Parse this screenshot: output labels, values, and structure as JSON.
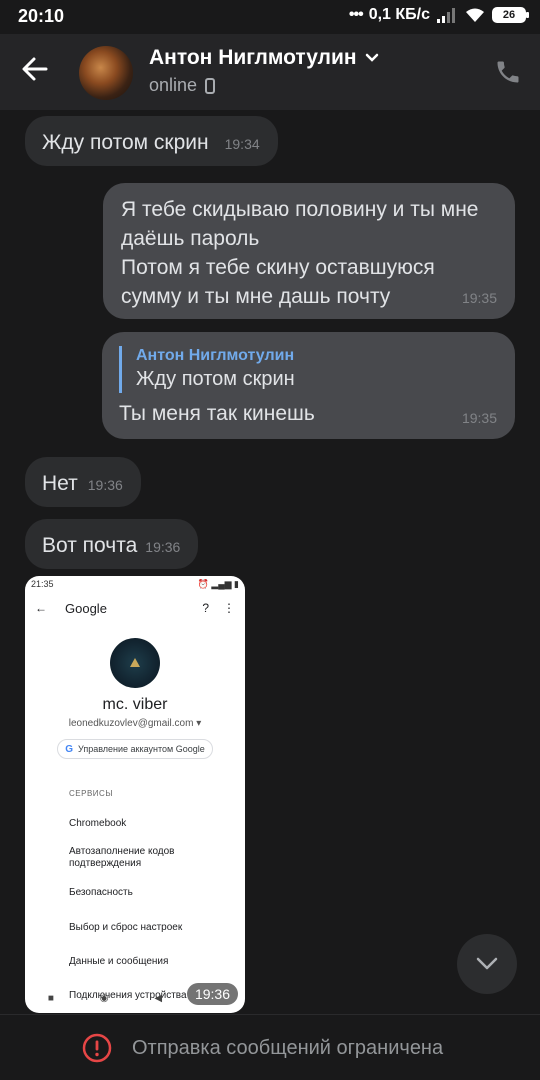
{
  "status_bar": {
    "time": "20:10",
    "network_speed": "0,1 КБ/с",
    "battery": "26"
  },
  "header": {
    "contact_name": "Антон Ниглмотулин",
    "status": "online"
  },
  "messages": [
    {
      "direction": "incoming",
      "text": "Жду потом скрин",
      "time": "19:34"
    },
    {
      "direction": "outgoing",
      "lines": [
        "Я тебе скидываю половину и ты мне",
        "даёшь пароль",
        "Потом я тебе скину оставшуюся",
        "сумму и ты мне дашь почту"
      ],
      "time": "19:35"
    },
    {
      "direction": "outgoing",
      "reply_author": "Антон Ниглмотулин",
      "reply_text": "Жду потом скрин",
      "text": "Ты меня так кинешь",
      "time": "19:35"
    },
    {
      "direction": "incoming",
      "text": "Нет",
      "time": "19:36"
    },
    {
      "direction": "incoming",
      "text": "Вот почта",
      "time": "19:36"
    },
    {
      "direction": "incoming",
      "type": "image",
      "time": "19:36"
    }
  ],
  "screenshot": {
    "status_time": "21:35",
    "app_title": "Google",
    "account_name": "mc. viber",
    "email": "leonedkuzovlev@gmail.com",
    "manage_label": "Управление аккаунтом Google",
    "section": "СЕРВИСЫ",
    "items": [
      "Chromebook",
      "Автозаполнение кодов подтверждения",
      "Безопасность",
      "Выбор и сброс настроек",
      "Данные и сообщения",
      "Подключения устройства"
    ]
  },
  "bottom": {
    "restriction_text": "Отправка сообщений ограничена"
  },
  "colors": {
    "background": "#19191a",
    "header": "#252527",
    "incoming_bubble": "#2c2d2f",
    "outgoing_bubble": "#48494d",
    "accent": "#71aaeb",
    "alert": "#e64646"
  }
}
